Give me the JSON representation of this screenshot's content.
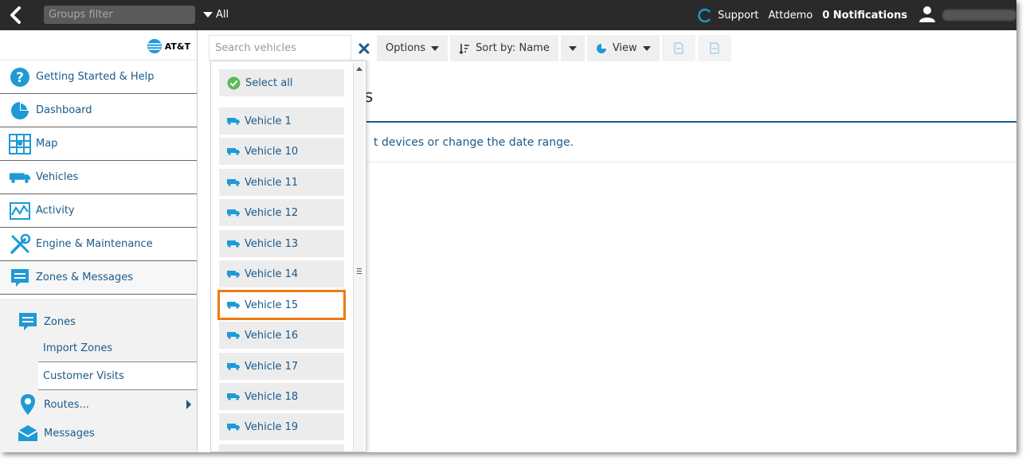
{
  "topbar": {
    "groups_filter_placeholder": "Groups filter",
    "all_label": "All",
    "support_label": "Support",
    "account_label": "Attdemo",
    "notifications_label": "0 Notifications"
  },
  "sidebar": {
    "logo_text": "AT&T",
    "items": [
      {
        "label": "Getting Started & Help",
        "icon": "help-icon"
      },
      {
        "label": "Dashboard",
        "icon": "dashboard-icon"
      },
      {
        "label": "Map",
        "icon": "map-icon"
      },
      {
        "label": "Vehicles",
        "icon": "vehicles-icon"
      },
      {
        "label": "Activity",
        "icon": "activity-icon"
      },
      {
        "label": "Engine & Maintenance",
        "icon": "engine-icon"
      },
      {
        "label": "Zones & Messages",
        "icon": "zones-messages-icon"
      }
    ],
    "sub": {
      "zones": "Zones",
      "import_zones": "Import Zones",
      "customer_visits": "Customer Visits",
      "routes": "Routes...",
      "messages": "Messages"
    }
  },
  "toolbar": {
    "search_placeholder": "Search vehicles",
    "options_label": "Options",
    "sort_label": "Sort by: Name",
    "view_label": "View"
  },
  "main": {
    "title_fragment": "s",
    "message": "t devices or change the date range."
  },
  "dropdown": {
    "select_all": "Select all",
    "vehicles": [
      "Vehicle 1",
      "Vehicle 10",
      "Vehicle 11",
      "Vehicle 12",
      "Vehicle 13",
      "Vehicle 14",
      "Vehicle 15",
      "Vehicle 16",
      "Vehicle 17",
      "Vehicle 18",
      "Vehicle 19"
    ],
    "highlighted": "Vehicle 15"
  },
  "colors": {
    "accent": "#1a5a8a",
    "icon_blue": "#1e9ad6",
    "highlight": "#f07a10",
    "topbar": "#2a2a2a"
  }
}
